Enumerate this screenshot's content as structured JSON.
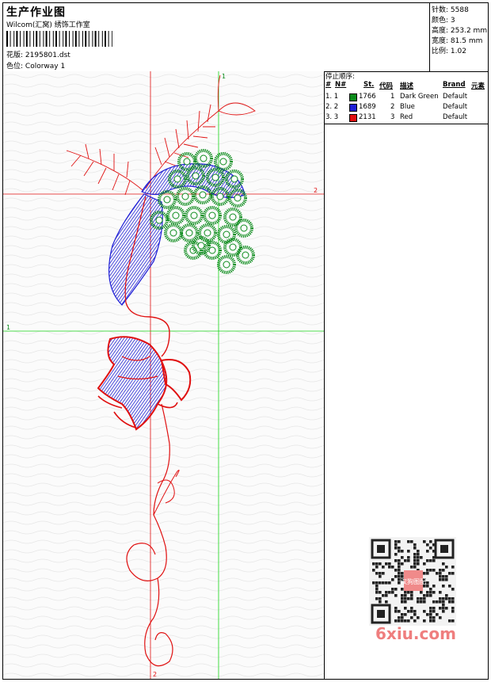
{
  "header": {
    "title": "生产作业图",
    "company": "Wilcom(汇窝) 绣饰工作室",
    "design_label": "花版:",
    "design_value": "2195801.dst",
    "colorway_label": "色位:",
    "colorway_value": "Colorway 1"
  },
  "stats": {
    "stitches_label": "针数:",
    "stitches_value": "5588",
    "colors_label": "颜色:",
    "colors_value": "3",
    "height_label": "高度:",
    "height_value": "253.2 mm",
    "width_label": "宽度:",
    "width_value": "81.5 mm",
    "scale_label": "比例:",
    "scale_value": "1.02"
  },
  "stop_sequence": {
    "label": "停止顺序:",
    "headers": {
      "hash": "#",
      "no": "N#",
      "st": "St.",
      "code": "代码",
      "desc": "描述",
      "brand": "Brand",
      "element": "元素"
    },
    "rows": [
      {
        "idx": "1. 1",
        "color": "#0a8a1a",
        "st": "1766",
        "code": "1",
        "desc": "Dark Green",
        "brand": "Default"
      },
      {
        "idx": "2. 2",
        "color": "#1f1fd6",
        "st": "1689",
        "code": "2",
        "desc": "Blue",
        "brand": "Default"
      },
      {
        "idx": "3. 3",
        "color": "#e01010",
        "st": "2131",
        "code": "3",
        "desc": "Red",
        "brand": "Default"
      }
    ]
  },
  "guides": {
    "h1": "1",
    "h2": "2",
    "v1": "1",
    "v2": "2"
  },
  "watermark": {
    "text": "6xiu.com",
    "seal": "汉狗图配"
  },
  "colors": {
    "green": "#0a8a1a",
    "blue": "#1f1fd6",
    "red": "#e01010"
  }
}
